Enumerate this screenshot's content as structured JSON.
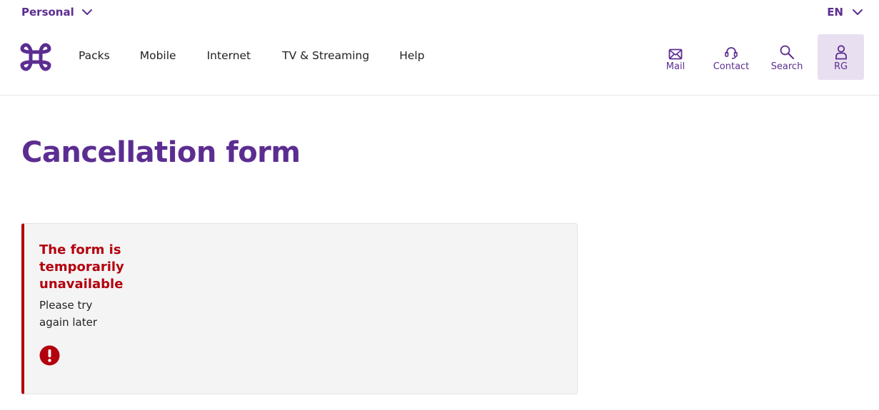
{
  "topbar": {
    "segment_label": "Personal",
    "language_label": "EN"
  },
  "nav": {
    "items": [
      {
        "label": "Packs"
      },
      {
        "label": "Mobile"
      },
      {
        "label": "Internet"
      },
      {
        "label": "TV & Streaming"
      },
      {
        "label": "Help"
      }
    ]
  },
  "utilities": {
    "mail": {
      "label": "Mail",
      "icon": "mail-icon"
    },
    "contact": {
      "label": "Contact",
      "icon": "headset-icon"
    },
    "search": {
      "label": "Search",
      "icon": "search-icon"
    },
    "account": {
      "label": "RG",
      "icon": "user-icon"
    }
  },
  "main": {
    "title": "Cancellation form",
    "alert": {
      "title": "The form is temporarily unavailable",
      "message": "Please try again later",
      "icon": "error-icon"
    }
  },
  "colors": {
    "brand": "#5c2d91",
    "error": "#b3000d",
    "account_bg": "#e8e0f1",
    "alert_bg": "#f4f4f4"
  }
}
